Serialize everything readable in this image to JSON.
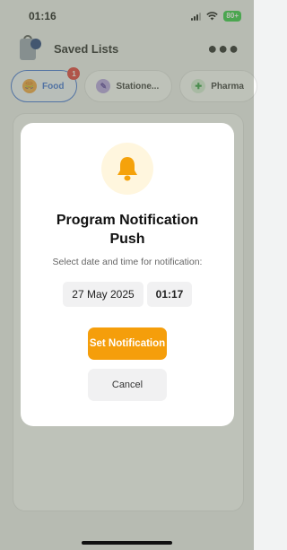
{
  "status_bar": {
    "time": "01:16",
    "battery": "80+"
  },
  "header": {
    "title": "Saved Lists",
    "more_icon": "ellipsis-icon"
  },
  "tabs": [
    {
      "label": "Food",
      "badge": "1",
      "icon": "food-icon"
    },
    {
      "label": "Statione...",
      "icon": "stationery-icon"
    },
    {
      "label": "Pharma",
      "icon": "pharmacy-icon"
    }
  ],
  "modal": {
    "icon": "bell-icon",
    "title": "Program Notification Push",
    "subtitle": "Select date and time for notification:",
    "date_value": "27 May 2025",
    "time_value": "01:17",
    "primary_label": "Set Notification",
    "secondary_label": "Cancel"
  },
  "colors": {
    "accent": "#f59e0b",
    "tab_active": "#3b6fd8",
    "badge": "#e53935"
  }
}
